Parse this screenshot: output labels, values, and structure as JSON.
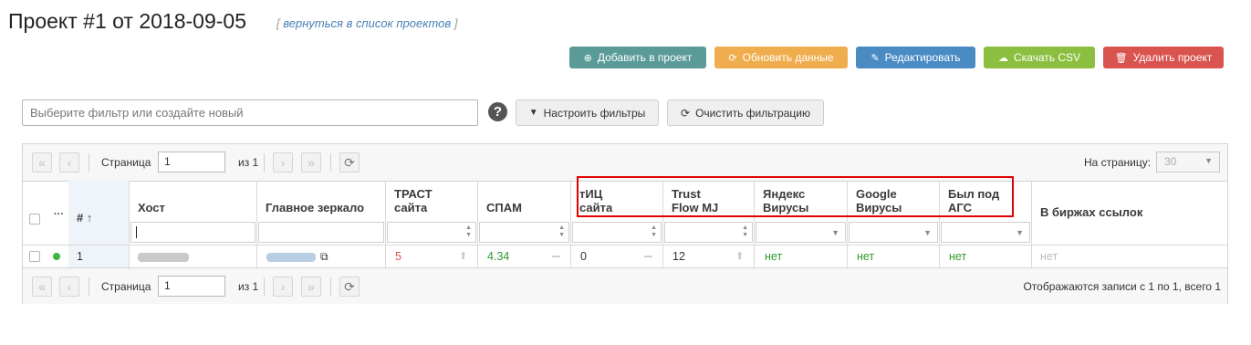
{
  "header": {
    "title": "Проект #1 от 2018-09-05",
    "back_open": "[",
    "back_link": "вернуться в список проектов",
    "back_close": "]"
  },
  "toolbar": {
    "add": "Добавить в проект",
    "update": "Обновить данные",
    "edit": "Редактировать",
    "csv": "Скачать CSV",
    "delete": "Удалить проект"
  },
  "filter": {
    "placeholder": "Выберите фильтр или создайте новый",
    "help": "?",
    "setup": "Настроить фильтры",
    "clear": "Очистить фильтрацию"
  },
  "pager": {
    "page_label": "Страница",
    "page_value": "1",
    "of_total": "из 1",
    "per_page_label": "На страницу:",
    "per_page_value": "30",
    "summary": "Отображаются записи с 1 по 1, всего 1"
  },
  "columns": {
    "dots": "···",
    "num": "#",
    "host": "Хост",
    "mirror": "Главное зеркало",
    "trust1": "ТРАСТ",
    "trust2": "сайта",
    "spam": "СПАМ",
    "tic1": "тИЦ",
    "tic2": "сайта",
    "tf1": "Trust",
    "tf2": "Flow MJ",
    "yv1": "Яндекс",
    "yv2": "Вирусы",
    "gv1": "Google",
    "gv2": "Вирусы",
    "ags1": "Был под",
    "ags2": "АГС",
    "exch": "В биржах ссылок"
  },
  "row": {
    "num": "1",
    "trust": "5",
    "spam": "4.34",
    "tic": "0",
    "tf": "12",
    "yandex": "нет",
    "google": "нет",
    "ags": "нет",
    "exchanges": "нет"
  },
  "colors": {
    "red_value": "#d9534f",
    "green_value": "#2e9a2e",
    "highlight": "#e00000"
  }
}
